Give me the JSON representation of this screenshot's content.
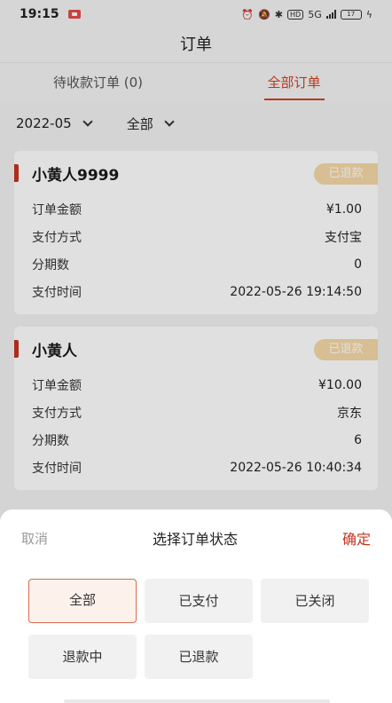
{
  "status_bar": {
    "time": "19:15",
    "hd": "HD",
    "network": "5G",
    "battery": "17"
  },
  "page_title": "订单",
  "tabs": [
    {
      "label": "待收款订单 (0)",
      "active": false
    },
    {
      "label": "全部订单",
      "active": true
    }
  ],
  "filters": {
    "month": "2022-05",
    "status": "全部"
  },
  "orders": [
    {
      "name": "小黄人9999",
      "status": "已退款",
      "rows": [
        {
          "label": "订单金额",
          "value": "¥1.00"
        },
        {
          "label": "支付方式",
          "value": "支付宝"
        },
        {
          "label": "分期数",
          "value": "0"
        },
        {
          "label": "支付时间",
          "value": "2022-05-26 19:14:50"
        }
      ]
    },
    {
      "name": "小黄人",
      "status": "已退款",
      "rows": [
        {
          "label": "订单金额",
          "value": "¥10.00"
        },
        {
          "label": "支付方式",
          "value": "京东"
        },
        {
          "label": "分期数",
          "value": "6"
        },
        {
          "label": "支付时间",
          "value": "2022-05-26 10:40:34"
        }
      ]
    }
  ],
  "picker": {
    "cancel": "取消",
    "title": "选择订单状态",
    "confirm": "确定",
    "options": [
      "全部",
      "已支付",
      "已关闭",
      "退款中",
      "已退款"
    ],
    "selected": "全部"
  },
  "colors": {
    "accent": "#c5331e",
    "badge": "#f5d9a8"
  }
}
